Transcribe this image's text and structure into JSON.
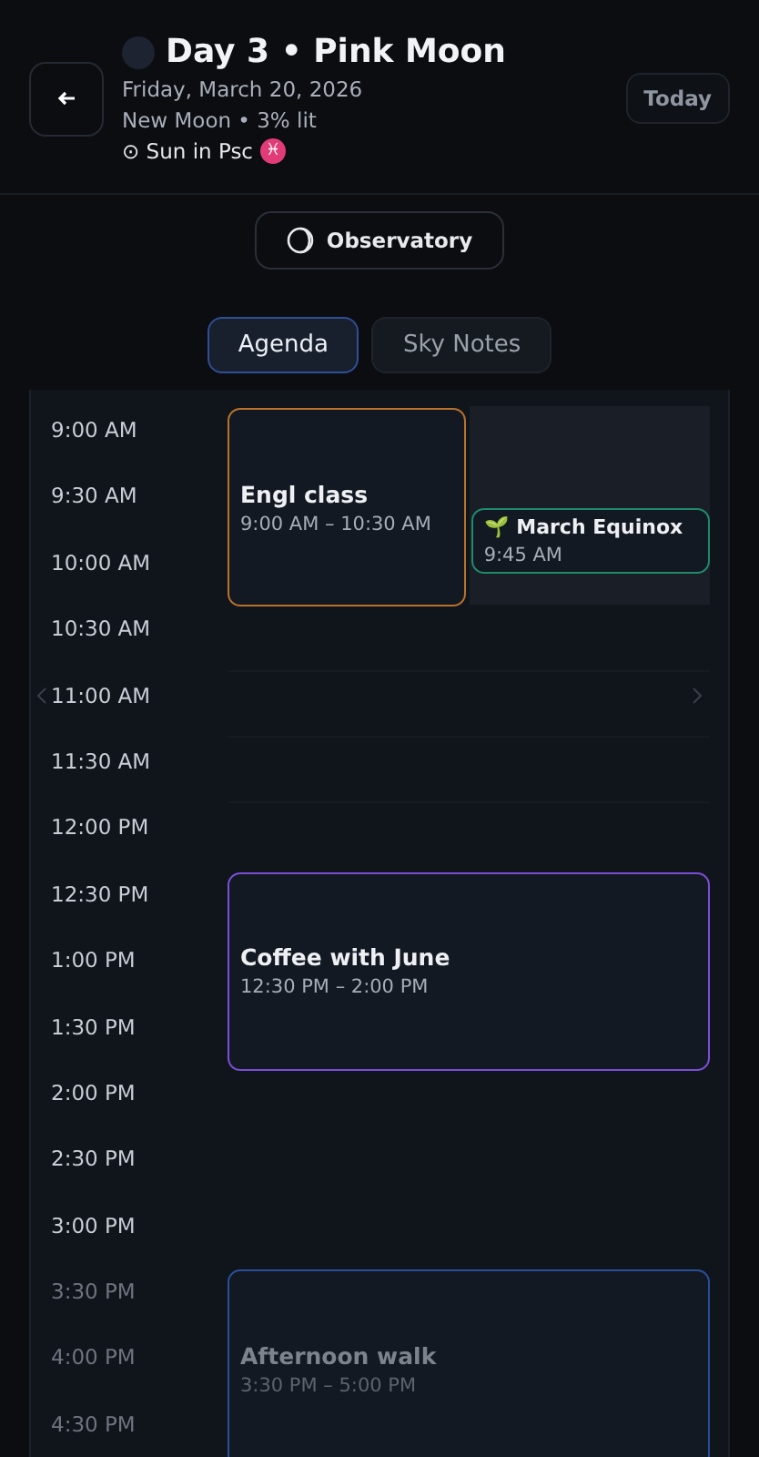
{
  "header": {
    "title": "Day 3 • Pink Moon",
    "date": "Friday, March 20, 2026",
    "phase": "New Moon • 3% lit",
    "sun": "⊙ Sun in Psc",
    "sign": "♓",
    "today": "Today"
  },
  "observatory": "Observatory",
  "tabs": [
    {
      "label": "Agenda",
      "selected": true
    },
    {
      "label": "Sky Notes",
      "selected": false
    }
  ],
  "times": [
    "9:00 AM",
    "9:30 AM",
    "10:00 AM",
    "10:30 AM",
    "11:00 AM",
    "11:30 AM",
    "12:00 PM",
    "12:30 PM",
    "1:00 PM",
    "1:30 PM",
    "2:00 PM",
    "2:30 PM",
    "3:00 PM",
    "3:30 PM",
    "4:00 PM",
    "4:30 PM"
  ],
  "events": [
    {
      "title": "Engl class",
      "time": "9:00 AM – 10:30 AM",
      "color": "#b8722a"
    },
    {
      "title": "🌱 March Equinox",
      "time": "9:45 AM",
      "color": "#1f8a6a"
    },
    {
      "title": "Coffee with June",
      "time": "12:30 PM – 2:00 PM",
      "color": "#7b4fd6"
    },
    {
      "title": "Afternoon walk",
      "time": "3:30 PM – 5:00 PM",
      "color": "#2a4f9a"
    }
  ]
}
